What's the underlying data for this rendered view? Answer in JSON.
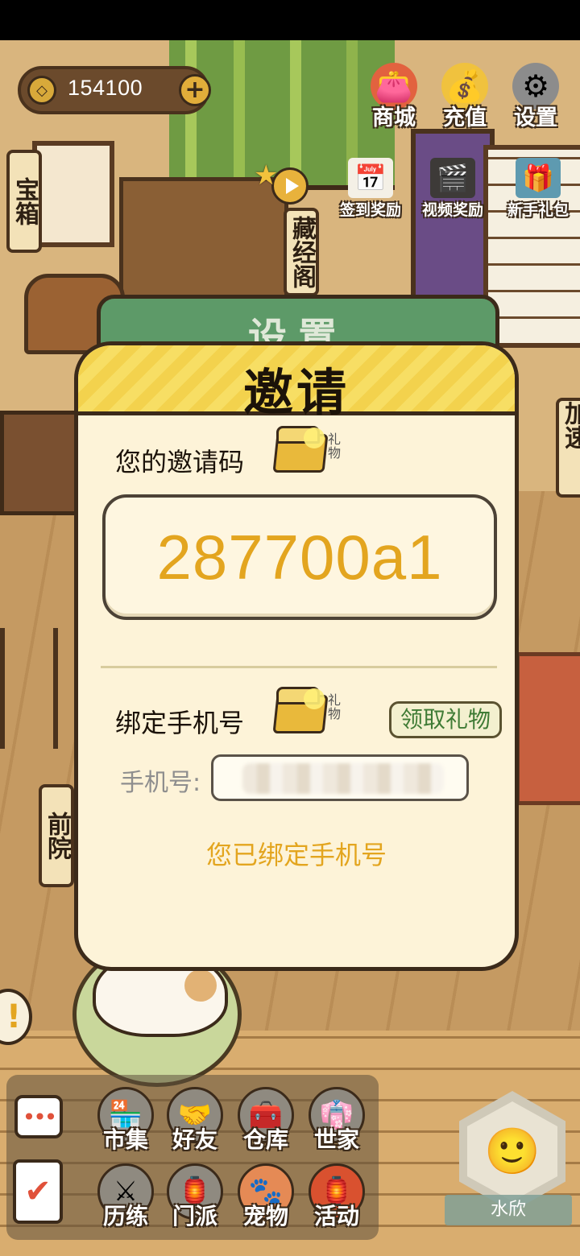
{
  "currency": {
    "amount": "154100",
    "plus_symbol": "+"
  },
  "top_menu": [
    {
      "label": "商城",
      "icon": "shop-bag-icon"
    },
    {
      "label": "充值",
      "icon": "gold-ingot-icon"
    },
    {
      "label": "设置",
      "icon": "gear-icon"
    }
  ],
  "rewards": [
    {
      "label": "签到奖励",
      "icon": "calendar-icon"
    },
    {
      "label": "视频奖励",
      "icon": "clapper-icon"
    },
    {
      "label": "新手礼包",
      "icon": "gift-chest-icon"
    }
  ],
  "side_tags": {
    "treasure": "宝箱",
    "library": "藏经阁",
    "front_yard": "前院",
    "right_tag": "加速"
  },
  "settings_panel": {
    "title": "设置"
  },
  "invite_dialog": {
    "title": "邀请",
    "invite_code_label": "您的邀请码",
    "gift_tag": "礼物",
    "invite_code": "287700a1",
    "bind_phone_label": "绑定手机号",
    "claim_button": "领取礼物",
    "phone_label": "手机号:",
    "status_message": "您已绑定手机号"
  },
  "dock": [
    {
      "label": "市集",
      "icon": "market-icon"
    },
    {
      "label": "好友",
      "icon": "handshake-icon"
    },
    {
      "label": "仓库",
      "icon": "storage-chest-icon"
    },
    {
      "label": "世家",
      "icon": "clan-robe-icon"
    },
    {
      "label": "历练",
      "icon": "swords-icon"
    },
    {
      "label": "门派",
      "icon": "sect-banner-icon"
    },
    {
      "label": "宠物",
      "icon": "paw-icon"
    },
    {
      "label": "活动",
      "icon": "lantern-icon"
    }
  ],
  "player": {
    "name": "水欣"
  },
  "colors": {
    "accent_gold": "#e3a51f",
    "dialog_bg": "#fdf3d8",
    "header_yellow": "#f7de64",
    "settings_green": "#5d9a68",
    "claim_green": "#3f7b35"
  }
}
